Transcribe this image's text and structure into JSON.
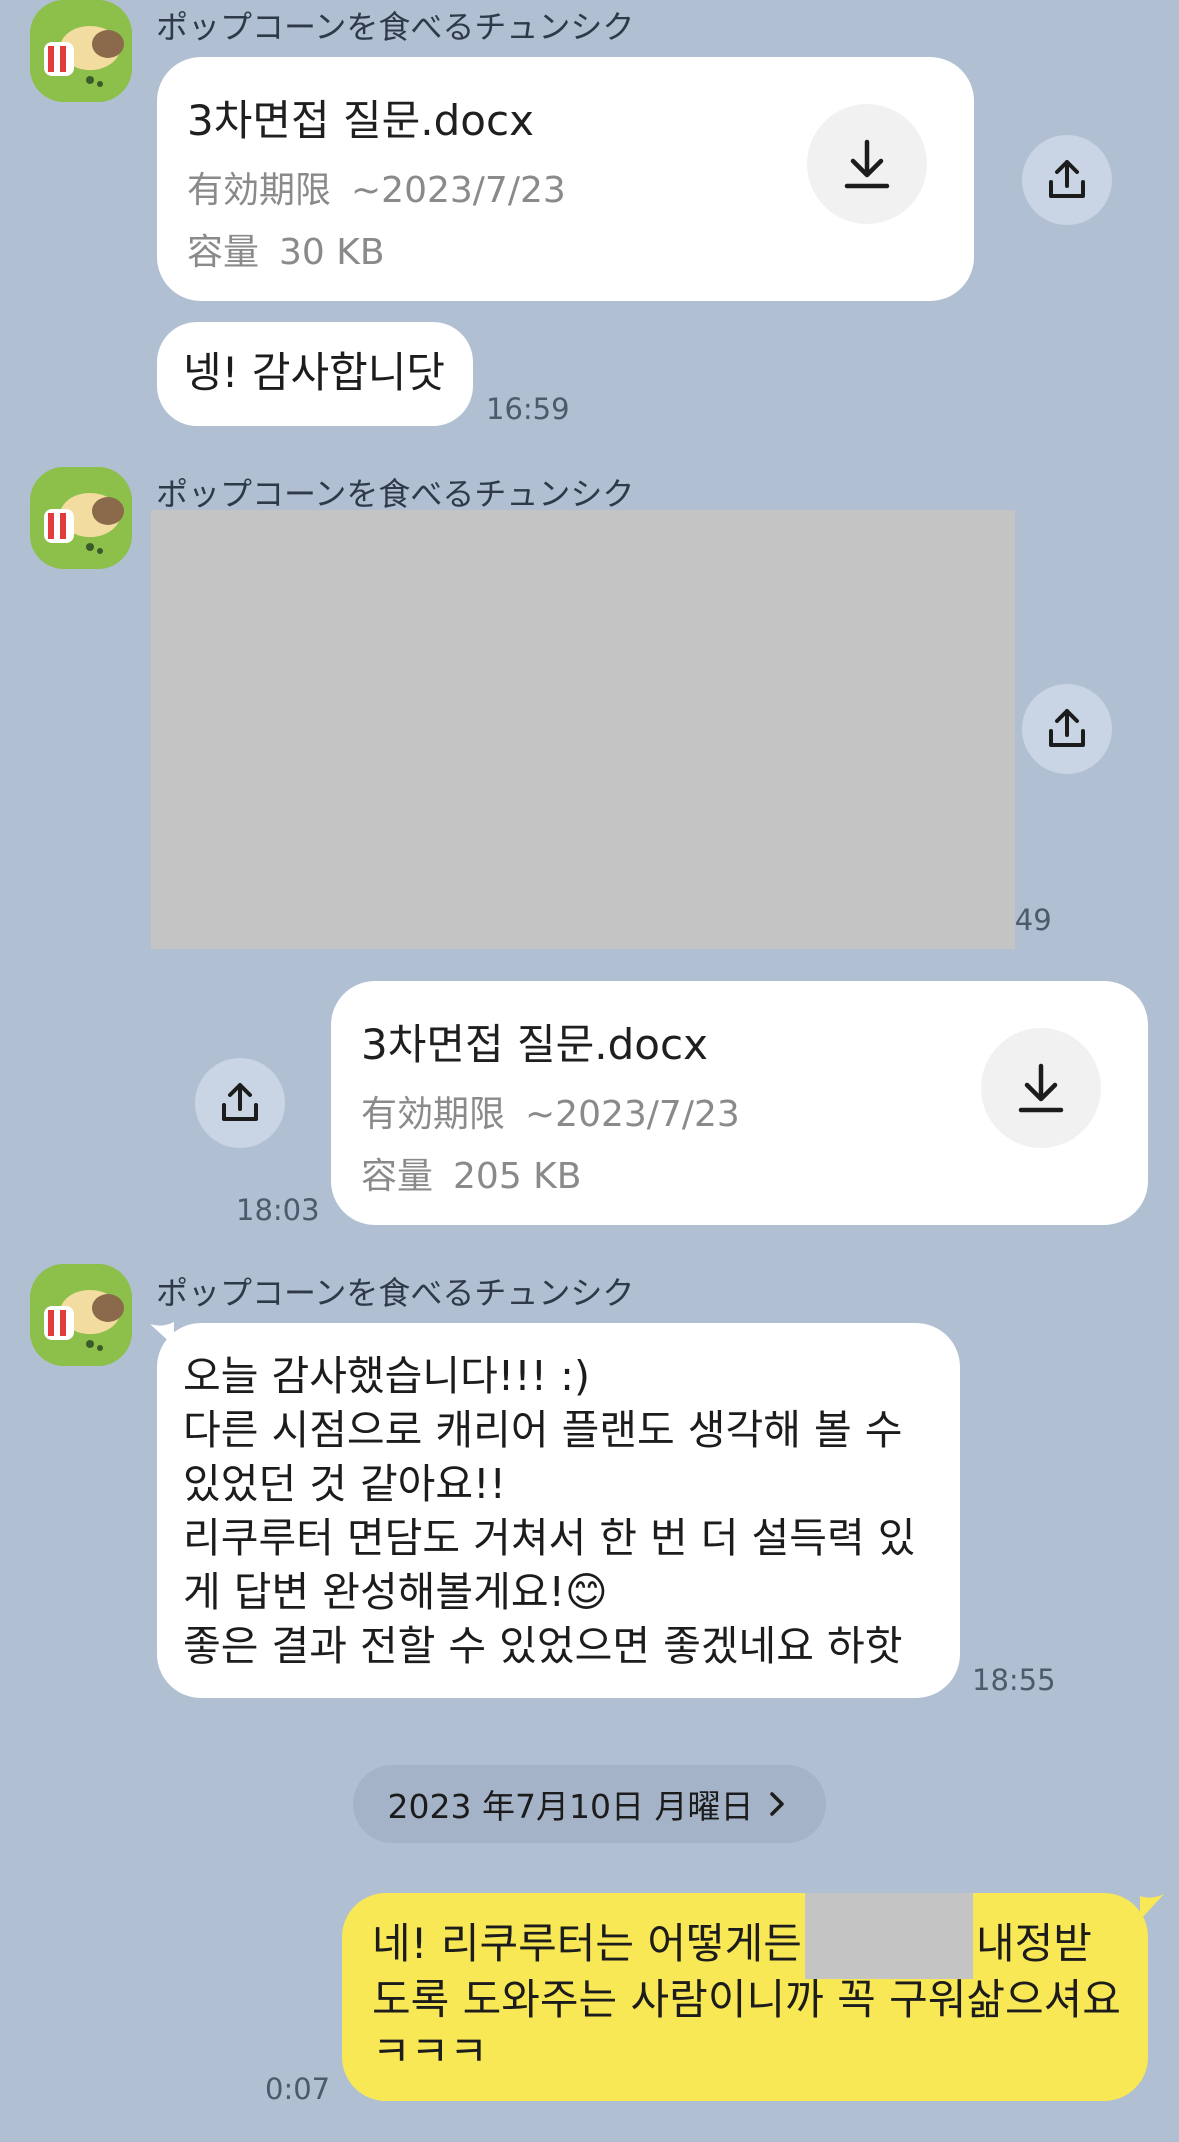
{
  "sender": "ポップコーンを食べるチュンシク",
  "file1": {
    "name": "3차면접 질문.docx",
    "expiry_label": "有効期限",
    "expiry_value": "~2023/7/23",
    "size_label": "容量",
    "size_value": "30 KB"
  },
  "msg1": {
    "text": "넹! 감사합니닷",
    "time": "16:59"
  },
  "image_msg": {
    "time": ":49"
  },
  "file2": {
    "name": "3차면접 질문.docx",
    "expiry_label": "有効期限",
    "expiry_value": "~2023/7/23",
    "size_label": "容量",
    "size_value": "205 KB",
    "time": "18:03"
  },
  "msg2": {
    "text": "오늘 감사했습니다!!! :)\n다른 시점으로 캐리어 플랜도 생각해 볼 수\n있었던 것 같아요!!\n리쿠루터 면담도 거쳐서 한 번 더 설득력 있\n게 답변 완성해볼게요!😊\n좋은 결과 전할 수 있었으면 좋겠네요 하핫",
    "time": "18:55"
  },
  "date_separator": "2023 年7月10日 月曜日",
  "msg3": {
    "line1_before": "네! 리쿠루터는 어떻게든",
    "line1_after": "내정받",
    "line2": "도록 도와주는 사람이니까 꼭 구워삶으셔요",
    "line3": "ㅋㅋㅋ",
    "time": "0:07"
  },
  "colors": {
    "background": "#b0bfd2",
    "bubble_other": "#ffffff",
    "bubble_self": "#f9e855",
    "avatar": "#8cc04a"
  },
  "icons": [
    "avatar-popcorn-icon",
    "download-icon",
    "share-icon",
    "chevron-right-icon"
  ]
}
